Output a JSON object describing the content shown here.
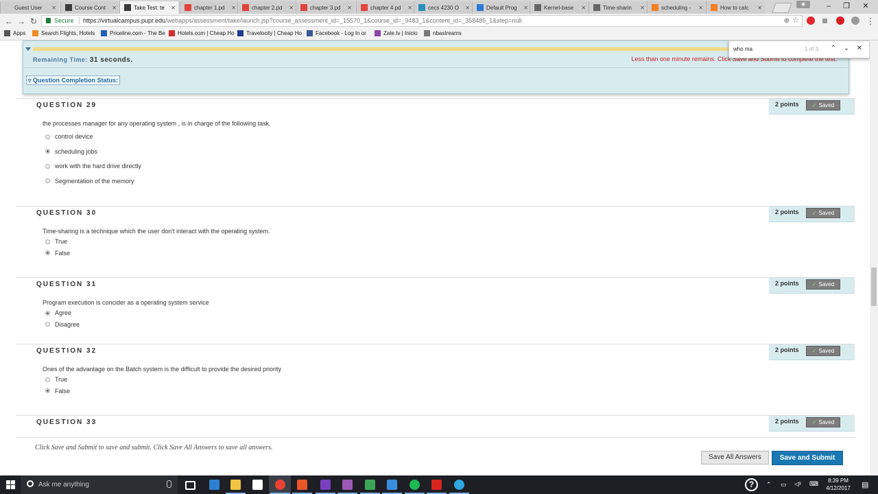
{
  "browser": {
    "tabs": [
      {
        "title": "Guest User",
        "icon": "page-icon",
        "color": "#cfcfcf"
      },
      {
        "title": "Course Cont",
        "icon": "bb-icon",
        "color": "#3a3a3a"
      },
      {
        "title": "Take Test: te",
        "icon": "bb-icon",
        "color": "#3a3a3a",
        "active": true
      },
      {
        "title": "chapter 1.pd",
        "icon": "pdf-icon",
        "color": "#e0443e"
      },
      {
        "title": "chapter 2.pd",
        "icon": "pdf-icon",
        "color": "#e0443e"
      },
      {
        "title": "chapter 3.pd",
        "icon": "pdf-icon",
        "color": "#e0443e"
      },
      {
        "title": "chapter 4.pd",
        "icon": "pdf-icon",
        "color": "#e0443e"
      },
      {
        "title": "cecs 4230 O",
        "icon": "ne-icon",
        "color": "#2a8fb8"
      },
      {
        "title": "Default Prog",
        "icon": "windows-icon",
        "color": "#2a7ad6"
      },
      {
        "title": "Kernel-base",
        "icon": "wiki-icon",
        "color": "#666666"
      },
      {
        "title": "Time-sharin",
        "icon": "wiki-icon",
        "color": "#666666"
      },
      {
        "title": "scheduling -",
        "icon": "so-icon",
        "color": "#f48024"
      },
      {
        "title": "How to calc",
        "icon": "so-icon",
        "color": "#f48024"
      }
    ],
    "secure_label": "Secure",
    "url_host": "https://virtualcampus.pupr.edu",
    "url_path": "/webapps/assessment/take/launch.jsp?course_assessment_id=_15570_1&course_id=_9483_1&content_id=_358485_1&step=null",
    "bookmarks": [
      {
        "label": "Apps",
        "color": "#555555"
      },
      {
        "label": "Search Flights, Hotels",
        "color": "#f08a24"
      },
      {
        "label": "Priceline.com - The Be",
        "color": "#1f5fb5"
      },
      {
        "label": "Hotels.com | Cheap Ho",
        "color": "#d32f2f"
      },
      {
        "label": "Travelocity | Cheap Ho",
        "color": "#1b3d8f"
      },
      {
        "label": "Facebook - Log In or",
        "color": "#3b5998"
      },
      {
        "label": "Zate.tv | Inicio",
        "color": "#8e44ad"
      },
      {
        "label": "nbastreams",
        "color": "#777777"
      }
    ],
    "find": {
      "query": "who ma",
      "count": "1 of 3"
    }
  },
  "status": {
    "remaining_label": "Remaining Time:",
    "remaining_value": "31 seconds.",
    "warning": "Less than one minute remains. Click Save and Submit to complete the test.",
    "completion_label": "Question Completion Status:"
  },
  "questions": [
    {
      "title": "QUESTION 29",
      "points": "2 points",
      "saved": "Saved",
      "text": "the  processes manager for any operating system , is in charge of the following task.",
      "options": [
        {
          "label": "control device",
          "selected": false
        },
        {
          "label": "scheduling jobs",
          "selected": true
        },
        {
          "label": "work with the hard drive directly",
          "selected": false
        },
        {
          "label": "Segmentation of the memory",
          "selected": false
        }
      ]
    },
    {
      "title": "QUESTION 30",
      "points": "2 points",
      "saved": "Saved",
      "text": "Time-sharing is a technique which the user don't interact with the operating system.",
      "options": [
        {
          "label": "True",
          "selected": false
        },
        {
          "label": "False",
          "selected": true
        }
      ]
    },
    {
      "title": "QUESTION 31",
      "points": "2 points",
      "saved": "Saved",
      "text": "Program execution is concider as a operating system service",
      "options": [
        {
          "label": "Agree",
          "selected": true
        },
        {
          "label": "Disagree",
          "selected": false
        }
      ]
    },
    {
      "title": "QUESTION 32",
      "points": "2 points",
      "saved": "Saved",
      "text": "Ones of the advantage on the Batch system is the difficult to provide the desired priority",
      "options": [
        {
          "label": "True",
          "selected": false
        },
        {
          "label": "False",
          "selected": true
        }
      ]
    },
    {
      "title": "QUESTION 33",
      "points": "2 points",
      "saved": "Saved",
      "text": "",
      "options": []
    }
  ],
  "footer": {
    "note": "Click Save and Submit to save and submit. Click Save All Answers to save all answers.",
    "save_all": "Save All Answers",
    "save_submit": "Save and Submit"
  },
  "taskbar": {
    "search_placeholder": "Ask me anything",
    "time": "8:39 PM",
    "date": "4/12/2017",
    "apps": [
      {
        "name": "task-view-icon",
        "color": "#ffffff"
      },
      {
        "name": "edge-icon",
        "color": "#2f7fd1"
      },
      {
        "name": "file-explorer-icon",
        "color": "#f4c542"
      },
      {
        "name": "store-icon",
        "color": "#ffffff"
      },
      {
        "name": "chrome-icon",
        "color": "#e94235"
      },
      {
        "name": "office-icon",
        "color": "#e8562a"
      },
      {
        "name": "paint-icon",
        "color": "#7a3fbf"
      },
      {
        "name": "purple-app-icon",
        "color": "#9b59b6"
      },
      {
        "name": "green-app-icon",
        "color": "#3aa655"
      },
      {
        "name": "photos-icon",
        "color": "#3a8dde"
      },
      {
        "name": "spotify-icon",
        "color": "#1db954"
      },
      {
        "name": "acrobat-icon",
        "color": "#d6261f"
      },
      {
        "name": "telegram-icon",
        "color": "#2ea6de"
      }
    ]
  }
}
